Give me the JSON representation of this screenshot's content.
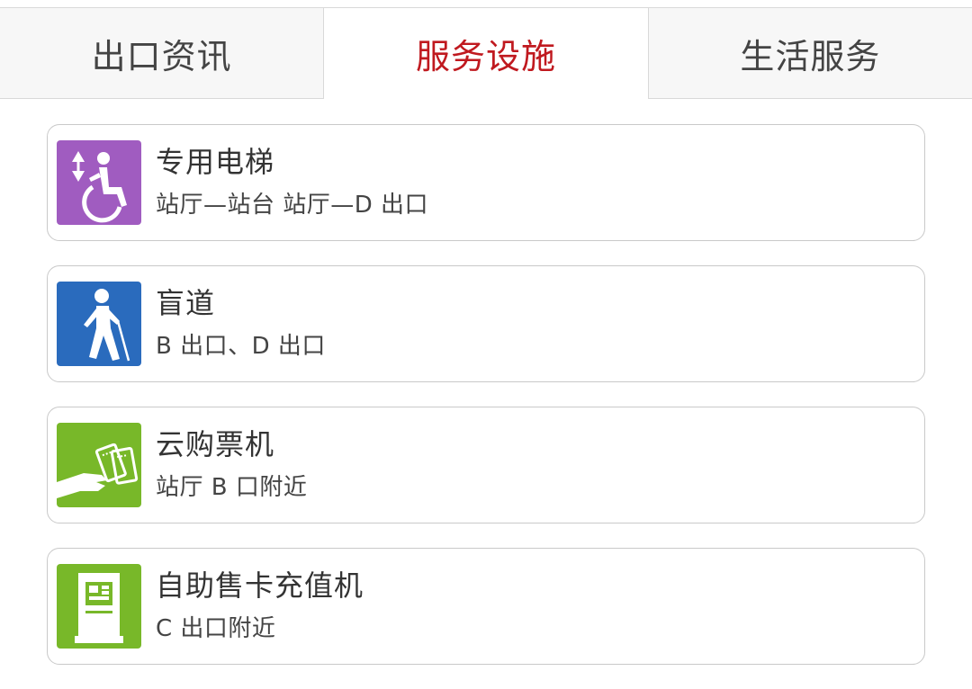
{
  "tabs": [
    {
      "label": "出口资讯",
      "active": false
    },
    {
      "label": "服务设施",
      "active": true
    },
    {
      "label": "生活服务",
      "active": false
    }
  ],
  "facilities": [
    {
      "icon": "wheelchair-elevator-icon",
      "color": "#a05cc0",
      "title": "专用电梯",
      "detail": "站厅—站台   站厅—D 出口"
    },
    {
      "icon": "blind-path-icon",
      "color": "#2a6bbd",
      "title": "盲道",
      "detail": "B 出口、D 出口"
    },
    {
      "icon": "cloud-ticket-machine-icon",
      "color": "#78b829",
      "title": "云购票机",
      "detail": "站厅 B 口附近"
    },
    {
      "icon": "card-recharge-machine-icon",
      "color": "#78b829",
      "title": "自助售卡充值机",
      "detail": "C 出口附近"
    }
  ],
  "colors": {
    "active_tab": "#c0191f",
    "inactive_tab": "#444444"
  }
}
